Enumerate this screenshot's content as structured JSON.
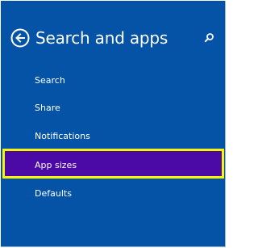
{
  "header": {
    "back_icon": "back-arrow-circle-icon",
    "title": "Search and apps",
    "search_icon": "search-icon"
  },
  "menu": {
    "items": [
      {
        "label": "Search"
      },
      {
        "label": "Share"
      },
      {
        "label": "Notifications"
      },
      {
        "label": "App sizes",
        "selected": true
      },
      {
        "label": "Defaults"
      }
    ]
  },
  "colors": {
    "panel_background": "#0453a6",
    "selected_background": "#4b0aa5",
    "selected_border": "#f5f50a",
    "text": "#ffffff"
  }
}
